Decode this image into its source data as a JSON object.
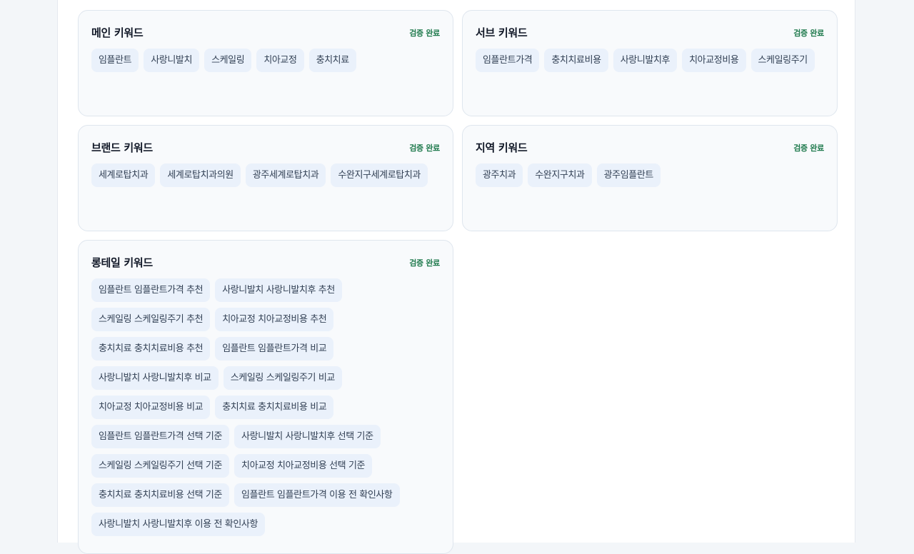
{
  "cards": [
    {
      "title": "메인 키워드",
      "status": "검증 완료",
      "keywords": [
        "임플란트",
        "사랑니발치",
        "스케일링",
        "치아교정",
        "충치치료"
      ]
    },
    {
      "title": "서브 키워드",
      "status": "검증 완료",
      "keywords": [
        "임플란트가격",
        "충치치료비용",
        "사랑니발치후",
        "치아교정비용",
        "스케일링주기"
      ]
    },
    {
      "title": "브랜드 키워드",
      "status": "검증 완료",
      "keywords": [
        "세계로탑치과",
        "세계로탑치과의원",
        "광주세계로탑치과",
        "수완지구세계로탑치과"
      ]
    },
    {
      "title": "지역 키워드",
      "status": "검증 완료",
      "keywords": [
        "광주치과",
        "수완지구치과",
        "광주임플란트"
      ]
    },
    {
      "title": "롱테일 키워드",
      "status": "검증 완료",
      "keywords": [
        "임플란트 임플란트가격 추천",
        "사랑니발치 사랑니발치후 추천",
        "스케일링 스케일링주기 추천",
        "치아교정 치아교정비용 추천",
        "충치치료 충치치료비용 추천",
        "임플란트 임플란트가격 비교",
        "사랑니발치 사랑니발치후 비교",
        "스케일링 스케일링주기 비교",
        "치아교정 치아교정비용 비교",
        "충치치료 충치치료비용 비교",
        "임플란트 임플란트가격 선택 기준",
        "사랑니발치 사랑니발치후 선택 기준",
        "스케일링 스케일링주기 선택 기준",
        "치아교정 치아교정비용 선택 기준",
        "충치치료 충치치료비용 선택 기준",
        "임플란트 임플란트가격 이용 전 확인사항",
        "사랑니발치 사랑니발치후 이용 전 확인사항"
      ]
    }
  ],
  "colors": {
    "status": "#1f7a4d",
    "chip_bg": "#eaf1fb",
    "card_bg": "#f8fafc"
  }
}
